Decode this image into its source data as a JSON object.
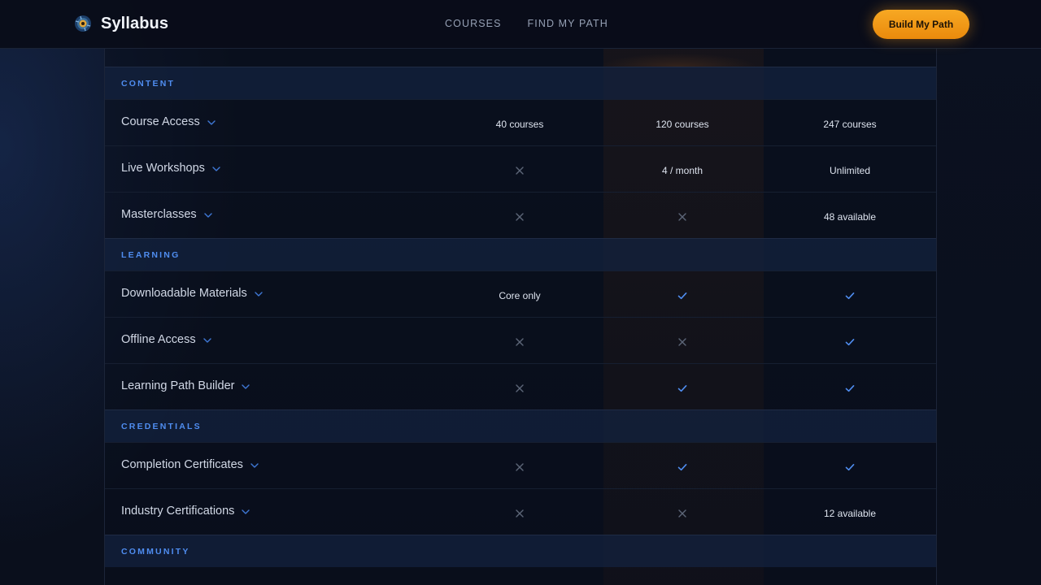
{
  "header": {
    "brand_name": "Syllabus",
    "nav": [
      "COURSES",
      "FIND MY PATH"
    ],
    "cta_label": "Build My Path"
  },
  "colors": {
    "accent_blue": "#4f8df0",
    "cta_orange": "#f39c1a",
    "background": "#0a0f1c"
  },
  "icons": {
    "included": "check-icon",
    "not_included": "x-icon",
    "expand": "chevron-down-icon"
  },
  "sections": [
    {
      "title": "CONTENT",
      "rows": [
        {
          "feature": "Course Access",
          "values": [
            "40 courses",
            "120 courses",
            "247 courses"
          ]
        },
        {
          "feature": "Live Workshops",
          "values": [
            "x",
            "4 / month",
            "Unlimited"
          ]
        },
        {
          "feature": "Masterclasses",
          "values": [
            "x",
            "x",
            "48 available"
          ]
        }
      ]
    },
    {
      "title": "LEARNING",
      "rows": [
        {
          "feature": "Downloadable Materials",
          "values": [
            "Core only",
            "check",
            "check"
          ]
        },
        {
          "feature": "Offline Access",
          "values": [
            "x",
            "x",
            "check"
          ]
        },
        {
          "feature": "Learning Path Builder",
          "values": [
            "x",
            "check",
            "check"
          ]
        }
      ]
    },
    {
      "title": "CREDENTIALS",
      "rows": [
        {
          "feature": "Completion Certificates",
          "values": [
            "x",
            "check",
            "check"
          ]
        },
        {
          "feature": "Industry Certifications",
          "values": [
            "x",
            "x",
            "12 available"
          ]
        }
      ]
    },
    {
      "title": "COMMUNITY",
      "rows": []
    }
  ]
}
